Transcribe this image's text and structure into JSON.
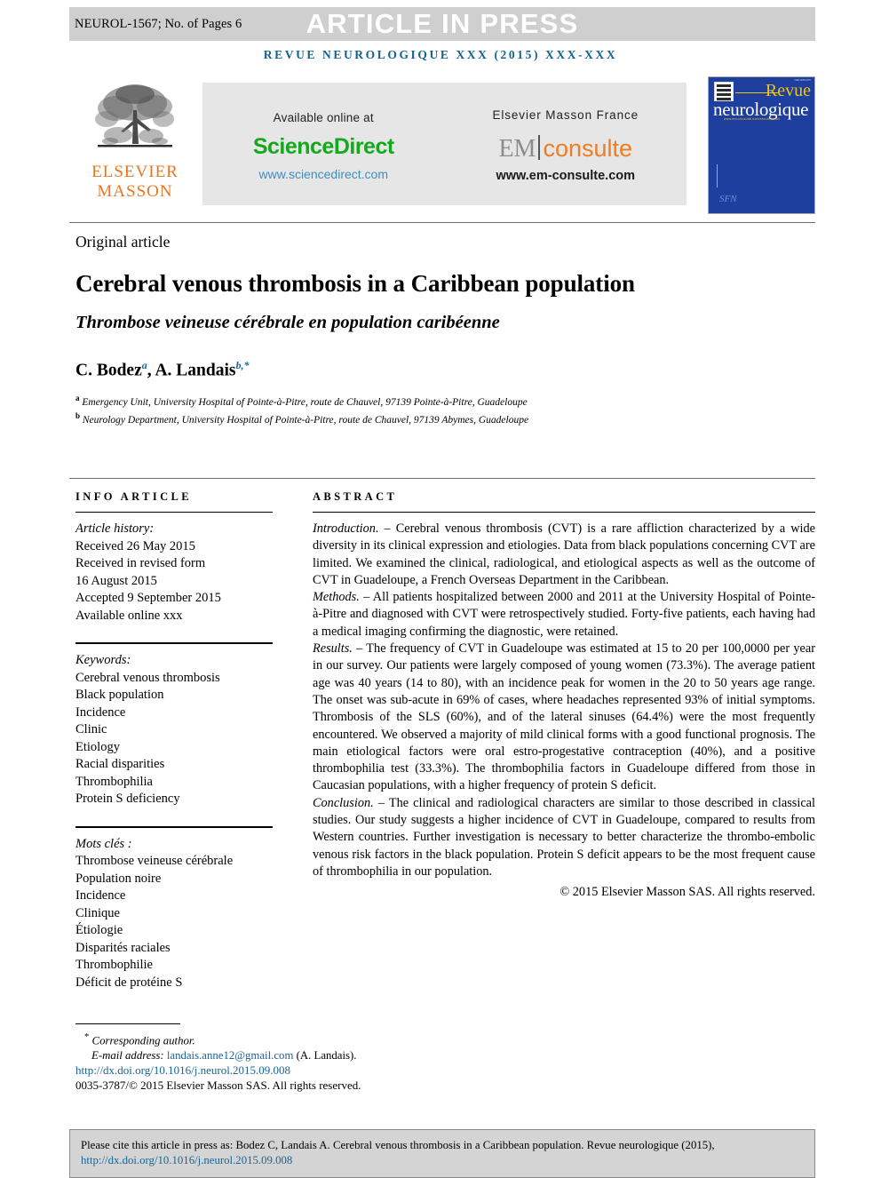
{
  "banner": {
    "code": "NEUROL-1567; No. of Pages 6",
    "press": "ARTICLE IN PRESS",
    "bg_color": "#cfcfcf"
  },
  "journal_line": "REVUE NEUROLOGIQUE XXX (2015) XXX-XXX",
  "journal_line_color": "#13618f",
  "masthead": {
    "publisher_name_line1": "ELSEVIER",
    "publisher_name_line2": "MASSON",
    "sciencedirect": {
      "caption": "Available online at",
      "wordmark": "ScienceDirect",
      "url": "www.sciencedirect.com",
      "color": "#14a81c"
    },
    "emconsulte": {
      "caption": "Elsevier Masson France",
      "wordmark_left": "EM",
      "wordmark_right": "consulte",
      "url": "www.em-consulte.com",
      "color": "#ee7d22"
    },
    "cover": {
      "title_top": "Revue",
      "title_bottom": "neurologique",
      "subtitle": "www.em-consulte.com/revue/neurol",
      "society": "SFN",
      "bg_color": "#1e3f9e"
    }
  },
  "article": {
    "kicker": "Original article",
    "title_en": "Cerebral venous thrombosis in a Caribbean population",
    "title_fr": "Thrombose veineuse cérébrale en population caribéenne",
    "authors": [
      {
        "name": "C. Bodez",
        "marks": "a"
      },
      {
        "name": "A. Landais",
        "marks": "b,*"
      }
    ],
    "affiliations": [
      {
        "mark": "a",
        "text": "Emergency Unit, University Hospital of Pointe-à-Pitre, route de Chauvel, 97139 Pointe-à-Pitre, Guadeloupe"
      },
      {
        "mark": "b",
        "text": "Neurology Department, University Hospital of Pointe-à-Pitre, route de Chauvel, 97139 Abymes, Guadeloupe"
      }
    ]
  },
  "info_article": {
    "heading": "INFO ARTICLE",
    "history_label": "Article history:",
    "history": [
      "Received 26 May 2015",
      "Received in revised form",
      "16 August 2015",
      "Accepted 9 September 2015",
      "Available online xxx"
    ],
    "keywords_label": "Keywords:",
    "keywords": [
      "Cerebral venous thrombosis",
      "Black population",
      "Incidence",
      "Clinic",
      "Etiology",
      "Racial disparities",
      "Thrombophilia",
      "Protein S deficiency"
    ],
    "motscles_label": "Mots clés :",
    "motscles": [
      "Thrombose veineuse cérébrale",
      "Population noire",
      "Incidence",
      "Clinique",
      "Étiologie",
      "Disparités raciales",
      "Thrombophilie",
      "Déficit de protéine S"
    ]
  },
  "abstract": {
    "heading": "ABSTRACT",
    "sections": [
      {
        "label": "Introduction.",
        "text": " – Cerebral venous thrombosis (CVT) is a rare affliction characterized by a wide diversity in its clinical expression and etiologies. Data from black populations concerning CVT are limited. We examined the clinical, radiological, and etiological aspects as well as the outcome of CVT in Guadeloupe, a French Overseas Department in the Caribbean."
      },
      {
        "label": "Methods.",
        "text": " – All patients hospitalized between 2000 and 2011 at the University Hospital of Pointe-à-Pitre and diagnosed with CVT were retrospectively studied. Forty-five patients, each having had a medical imaging confirming the diagnostic, were retained."
      },
      {
        "label": "Results.",
        "text": " – The frequency of CVT in Guadeloupe was estimated at 15 to 20 per 100,0000 per year in our survey. Our patients were largely composed of young women (73.3%). The average patient age was 40 years (14 to 80), with an incidence peak for women in the 20 to 50 years age range. The onset was sub-acute in 69% of cases, where headaches represented 93% of initial symptoms. Thrombosis of the SLS (60%), and of the lateral sinuses (64.4%) were the most frequently encountered. We observed a majority of mild clinical forms with a good functional prognosis. The main etiological factors were oral estro-progestative contraception (40%), and a positive thrombophilia test (33.3%). The thrombophilia factors in Guadeloupe differed from those in Caucasian populations, with a higher frequency of protein S deficit."
      },
      {
        "label": "Conclusion.",
        "text": " – The clinical and radiological characters are similar to those described in classical studies. Our study suggests a higher incidence of CVT in Guadeloupe, compared to results from Western countries. Further investigation is necessary to better characterize the thrombo-embolic venous risk factors in the black population. Protein S deficit appears to be the most frequent cause of thrombophilia in our population."
      }
    ],
    "copyright": "© 2015 Elsevier Masson SAS. All rights reserved."
  },
  "footnote": {
    "corresponding_marker": "*",
    "corresponding_label": "Corresponding author.",
    "email_label": "E-mail address:",
    "email": "landais.anne12@gmail.com",
    "email_attrib": "(A. Landais).",
    "doi": "http://dx.doi.org/10.1016/j.neurol.2015.09.008",
    "issn_line": "0035-3787/© 2015 Elsevier Masson SAS. All rights reserved.",
    "link_color": "#1a6496"
  },
  "citation_box": {
    "text": "Please cite this article in press as: Bodez C, Landais  A. Cerebral venous thrombosis in a Caribbean population. Revue neurologique (2015), ",
    "link": "http://dx.doi.org/10.1016/j.neurol.2015.09.008",
    "bg_color": "#d4d4d4"
  }
}
